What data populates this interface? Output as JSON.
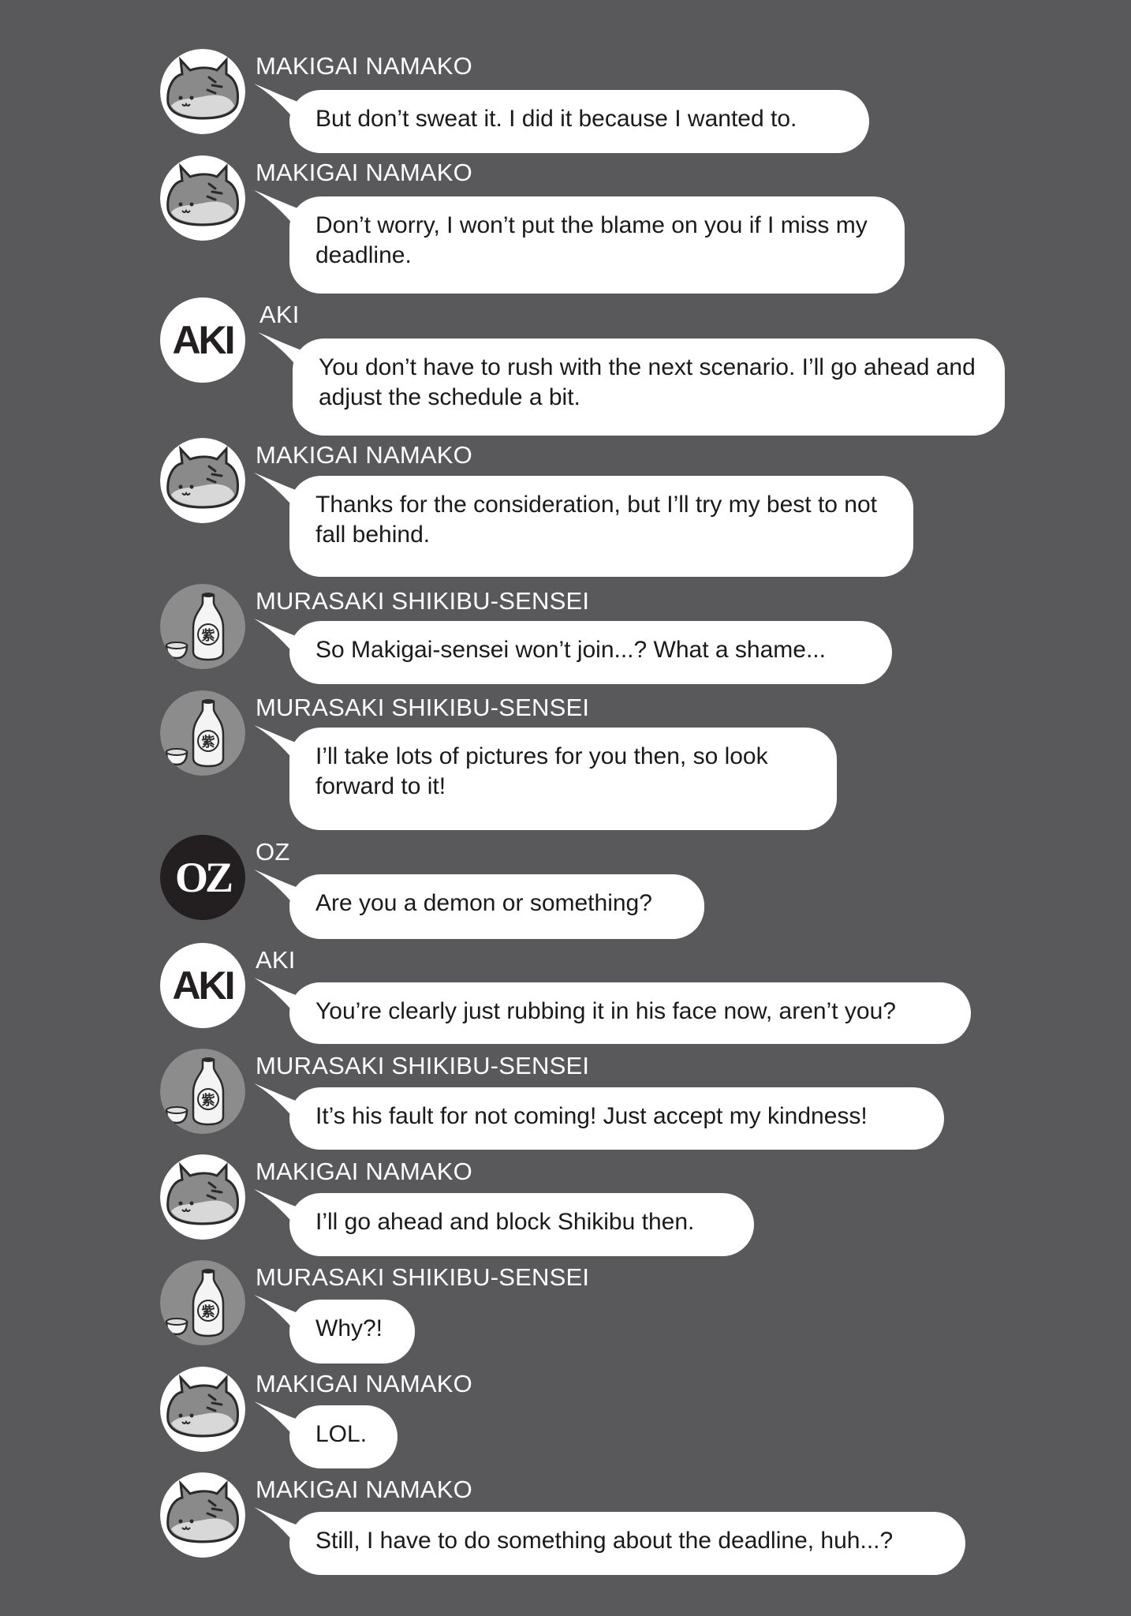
{
  "messages": [
    {
      "sender": "MAKIGAI NAMAKO",
      "avatar": "cat-namako-icon",
      "text": "But don’t sweat it. I did it because I wanted to."
    },
    {
      "sender": "MAKIGAI NAMAKO",
      "avatar": "cat-namako-icon",
      "text": "Don’t worry, I won’t put the blame on you if I miss my deadline."
    },
    {
      "sender": "AKI",
      "avatar": "aki-icon",
      "avatar_text": "AKI",
      "text": "You don’t have to rush with the next scenario. I’ll go ahead and adjust the schedule a bit."
    },
    {
      "sender": "MAKIGAI NAMAKO",
      "avatar": "cat-namako-icon",
      "text": "Thanks for the consideration, but I’ll try my best to not fall behind."
    },
    {
      "sender": "MURASAKI SHIKIBU-SENSEI",
      "avatar": "sake-bottle-icon",
      "avatar_text": "紫",
      "text": "So Makigai-sensei won’t join...? What a shame..."
    },
    {
      "sender": "MURASAKI SHIKIBU-SENSEI",
      "avatar": "sake-bottle-icon",
      "avatar_text": "紫",
      "text": "I’ll take lots of pictures for you then, so look forward to it!"
    },
    {
      "sender": "OZ",
      "avatar": "oz-icon",
      "avatar_text": "OZ",
      "text": "Are you a demon or something?"
    },
    {
      "sender": "AKI",
      "avatar": "aki-icon",
      "avatar_text": "AKI",
      "text": "You’re clearly just rubbing it in his face now, aren’t you?"
    },
    {
      "sender": "MURASAKI SHIKIBU-SENSEI",
      "avatar": "sake-bottle-icon",
      "avatar_text": "紫",
      "text": "It’s his fault for not coming! Just accept my kindness!"
    },
    {
      "sender": "MAKIGAI NAMAKO",
      "avatar": "cat-namako-icon",
      "text": "I’ll go ahead and block Shikibu then."
    },
    {
      "sender": "MURASAKI SHIKIBU-SENSEI",
      "avatar": "sake-bottle-icon",
      "avatar_text": "紫",
      "text": "Why?!"
    },
    {
      "sender": "MAKIGAI NAMAKO",
      "avatar": "cat-namako-icon",
      "text": "LOL."
    },
    {
      "sender": "MAKIGAI NAMAKO",
      "avatar": "cat-namako-icon",
      "text": "Still, I have to do something about the deadline, huh...?"
    }
  ],
  "colors": {
    "background": "#59585a",
    "bubble": "#ffffff",
    "text": "#1a1a1a",
    "sender": "#ffffff",
    "oz_avatar": "#231f20"
  }
}
